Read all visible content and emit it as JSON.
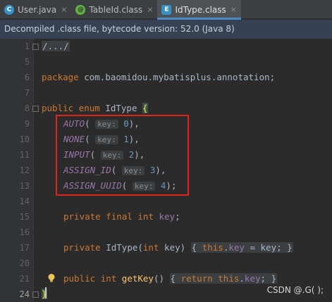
{
  "tabs": [
    {
      "label": "User.java",
      "icon": "class-c-icon",
      "glyph": "C"
    },
    {
      "label": "TableId.class",
      "icon": "annotation-icon",
      "glyph": "@"
    },
    {
      "label": "IdType.class",
      "icon": "enum-icon",
      "glyph": "E"
    }
  ],
  "tab_close": "×",
  "banner": "Decompiled .class file, bytecode version: 52.0 (Java 8)",
  "lines": [
    {
      "num": "1",
      "content": "/.../"
    },
    {
      "num": "5",
      "content": ""
    },
    {
      "num": "6",
      "content": "package com.baomidou.mybatisplus.annotation;"
    },
    {
      "num": "7",
      "content": ""
    },
    {
      "num": "8",
      "content": "public enum IdType {"
    },
    {
      "num": "9",
      "content": "AUTO( key: 0),"
    },
    {
      "num": "10",
      "content": "NONE( key: 1),"
    },
    {
      "num": "11",
      "content": "INPUT( key: 2),"
    },
    {
      "num": "12",
      "content": "ASSIGN_ID( key: 3),"
    },
    {
      "num": "13",
      "content": "ASSIGN_UUID( key: 4);"
    },
    {
      "num": "14",
      "content": ""
    },
    {
      "num": "15",
      "content": "private final int key;"
    },
    {
      "num": "16",
      "content": ""
    },
    {
      "num": "17",
      "content": "private IdType(int key) { this.key = key; }"
    },
    {
      "num": "20",
      "content": ""
    },
    {
      "num": "21",
      "content": "public int getKey() { return this.key; }"
    },
    {
      "num": "24",
      "content": "}"
    }
  ],
  "code": {
    "folded": "/.../",
    "kw_package": "package",
    "package_name": "com.baomidou.mybatisplus.annotation;",
    "kw_public": "public",
    "kw_enum": "enum",
    "enum_name": "IdType",
    "open_brace": "{",
    "close_brace": "}",
    "param_hint": "key:",
    "constants": [
      {
        "name": "AUTO",
        "value": "0",
        "end": "),"
      },
      {
        "name": "NONE",
        "value": "1",
        "end": "),"
      },
      {
        "name": "INPUT",
        "value": "2",
        "end": "),"
      },
      {
        "name": "ASSIGN_ID",
        "value": "3",
        "end": "),"
      },
      {
        "name": "ASSIGN_UUID",
        "value": "4",
        "end": ");"
      }
    ],
    "kw_private": "private",
    "kw_final": "final",
    "kw_int": "int",
    "field_key": "key",
    "kw_this": "this",
    "method_getkey": "getKey",
    "kw_return": "return"
  },
  "watermark": "CSDN @.G( );",
  "colors": {
    "highlight_box": "#e0241b",
    "accent_tab": "#4a88c7"
  }
}
